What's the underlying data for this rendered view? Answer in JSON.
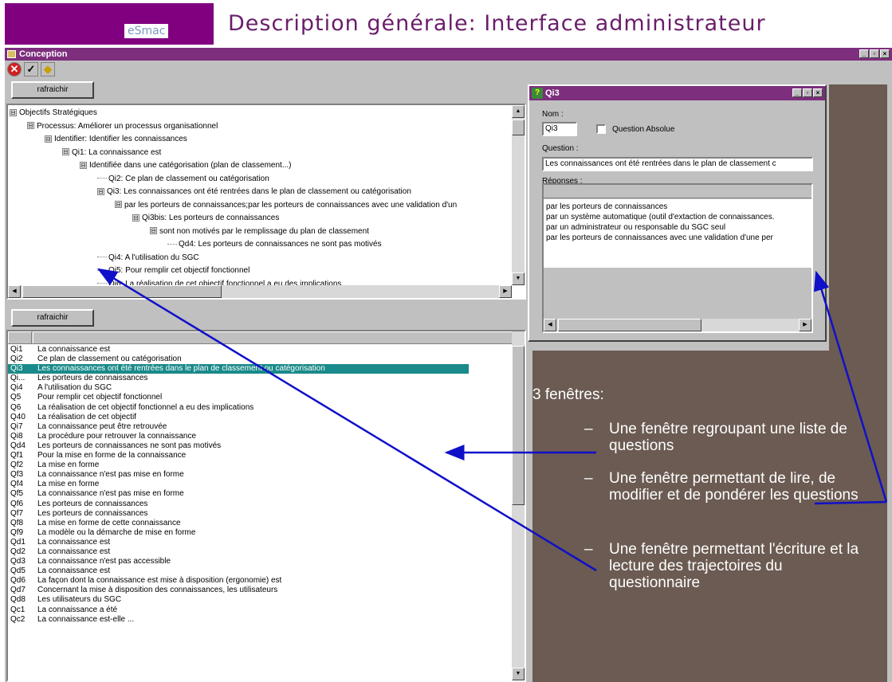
{
  "slide": {
    "logo": "eSmac",
    "title": "Description générale: Interface administrateur"
  },
  "window": {
    "title": "Conception",
    "buttons": [
      "_",
      "▫",
      "×"
    ]
  },
  "toolbar": {
    "icons": [
      "close-red-icon",
      "check-icon",
      "diamond-icon"
    ]
  },
  "tree_panel": {
    "refresh_label": "rafraichir",
    "items": [
      {
        "indent": 0,
        "toggle": "⊟",
        "label": "Objectifs Stratégiques"
      },
      {
        "indent": 1,
        "toggle": "⊟",
        "label": "Processus: Améliorer un processus organisationnel"
      },
      {
        "indent": 2,
        "toggle": "⊟",
        "label": "Identifier: Identifier les connaissances"
      },
      {
        "indent": 3,
        "toggle": "⊟",
        "label": "Qi1: La connaissance est"
      },
      {
        "indent": 4,
        "toggle": "⊟",
        "label": "Identifiée dans une catégorisation (plan de classement...)"
      },
      {
        "indent": 5,
        "toggle": "",
        "label": "Qi2: Ce plan de classement ou catégorisation"
      },
      {
        "indent": 5,
        "toggle": "⊟",
        "label": "Qi3: Les connaissances ont été rentrées dans le plan de classement ou catégorisation"
      },
      {
        "indent": 6,
        "toggle": "⊟",
        "label": "par les porteurs de connaissances;par les porteurs de connaissances avec une validation d'un"
      },
      {
        "indent": 7,
        "toggle": "⊟",
        "label": "Qi3bis: Les porteurs de connaissances"
      },
      {
        "indent": 8,
        "toggle": "⊟",
        "label": "sont non motivés par le remplissage du plan de classement"
      },
      {
        "indent": 9,
        "toggle": "",
        "label": "Qd4: Les porteurs de connaissances ne sont pas motivés"
      },
      {
        "indent": 5,
        "toggle": "",
        "label": "Qi4: A l'utilisation du SGC"
      },
      {
        "indent": 5,
        "toggle": "",
        "label": "Qi5: Pour remplir cet objectif fonctionnel"
      },
      {
        "indent": 5,
        "toggle": "",
        "label": "Qi6: La réalisation de cet objectif fonctionnel a eu des implications"
      }
    ]
  },
  "list_panel": {
    "refresh_label": "rafraichir",
    "rows": [
      {
        "id": "Qi1",
        "text": "La connaissance est"
      },
      {
        "id": "Qi2",
        "text": "Ce plan de classement ou catégorisation"
      },
      {
        "id": "Qi3",
        "text": "Les connaissances ont été rentrées dans le plan de classement ou catégorisation",
        "selected": true
      },
      {
        "id": "Qi...",
        "text": "Les porteurs de connaissances"
      },
      {
        "id": "Qi4",
        "text": "A l'utilisation du SGC"
      },
      {
        "id": "Q5",
        "text": "Pour remplir cet objectif fonctionnel"
      },
      {
        "id": "Q6",
        "text": "La réalisation de cet objectif fonctionnel a eu des implications"
      },
      {
        "id": "Q40",
        "text": "La réalisation de cet objectif"
      },
      {
        "id": "Qi7",
        "text": "La connaissance peut être retrouvée"
      },
      {
        "id": "Qi8",
        "text": "La procédure pour retrouver la connaissance"
      },
      {
        "id": "Qd4",
        "text": "Les porteurs de connaissances ne sont pas motivés"
      },
      {
        "id": "Qf1",
        "text": "Pour la mise en forme de la connaissance"
      },
      {
        "id": "Qf2",
        "text": "La mise en forme"
      },
      {
        "id": "Qf3",
        "text": "La connaissance n'est pas mise en forme"
      },
      {
        "id": "Qf4",
        "text": "La mise en forme"
      },
      {
        "id": "Qf5",
        "text": "La connaissance n'est pas mise en forme"
      },
      {
        "id": "Qf6",
        "text": "Les porteurs de connaissances"
      },
      {
        "id": "Qf7",
        "text": "Les porteurs de connaissances"
      },
      {
        "id": "Qf8",
        "text": "La mise en forme de cette connaissance"
      },
      {
        "id": "Qf9",
        "text": "La modèle ou la démarche de mise en forme"
      },
      {
        "id": "Qd1",
        "text": "La connaissance est"
      },
      {
        "id": "Qd2",
        "text": "La connaissance est"
      },
      {
        "id": "Qd3",
        "text": "La connaissance n'est pas accessible"
      },
      {
        "id": "Qd5",
        "text": "La connaissance est"
      },
      {
        "id": "Qd6",
        "text": "La façon dont la connaissance est mise à disposition (ergonomie) est"
      },
      {
        "id": "Qd7",
        "text": "Concernant la mise à disposition des connaissances, les utilisateurs"
      },
      {
        "id": "Qd8",
        "text": "Les utilisateurs du SGC"
      },
      {
        "id": "Qc1",
        "text": "La connaissance a été"
      },
      {
        "id": "Qc2",
        "text": "La connaissance est-elle ..."
      }
    ]
  },
  "dialog": {
    "title": "Qi3",
    "nom_label": "Nom :",
    "nom_value": "Qi3",
    "absolute_label": "Question Absolue",
    "question_label": "Question :",
    "question_value": "Les connaissances ont été rentrées dans le plan de classement c",
    "responses_label": "Réponses :",
    "responses": [
      "par les porteurs de connaissances",
      "par un système automatique (outil d'extaction de connaissances.",
      "par un administrateur ou responsable du SGC seul",
      "par les porteurs de connaissances avec une validation d'une per"
    ]
  },
  "annotation": {
    "heading": "3 fenêtres:",
    "bullets": [
      {
        "dash": "–",
        "text": "Une fenêtre regroupant une liste de questions"
      },
      {
        "dash": "–",
        "text": "Une fenêtre permettant de lire, de modifier et de pondérer les questions"
      },
      {
        "dash": "–",
        "text": "Une fenêtre permettant l'écriture et la lecture des trajectoires du questionnaire"
      }
    ],
    "colors": {
      "panel": "#6b5b52",
      "arrow": "#1010c8",
      "selection": "#1a8a8a",
      "titlebar": "#7d2e7d"
    }
  }
}
